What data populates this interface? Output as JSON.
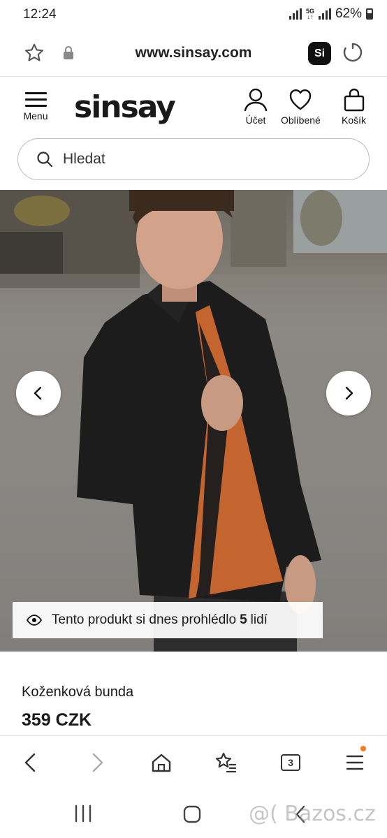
{
  "status_bar": {
    "time": "12:24",
    "network": "5G",
    "battery": "62%"
  },
  "browser": {
    "url": "www.sinsay.com",
    "app_badge": "Si",
    "tabs_count": "3"
  },
  "header": {
    "logo": "sinsay",
    "menu_label": "Menu",
    "account_label": "Účet",
    "favorites_label": "Oblíbené",
    "cart_label": "Košík"
  },
  "search": {
    "placeholder": "Hledat"
  },
  "product": {
    "viewers_prefix": "Tento produkt si dnes prohlédlo",
    "viewers_count": "5",
    "viewers_suffix": "lidí",
    "name": "Koženková bunda",
    "price": "359 CZK"
  },
  "watermark": "@( Bazos.cz",
  "colors": {
    "accent_dot": "#f07f1f",
    "text": "#1a1a1a"
  }
}
